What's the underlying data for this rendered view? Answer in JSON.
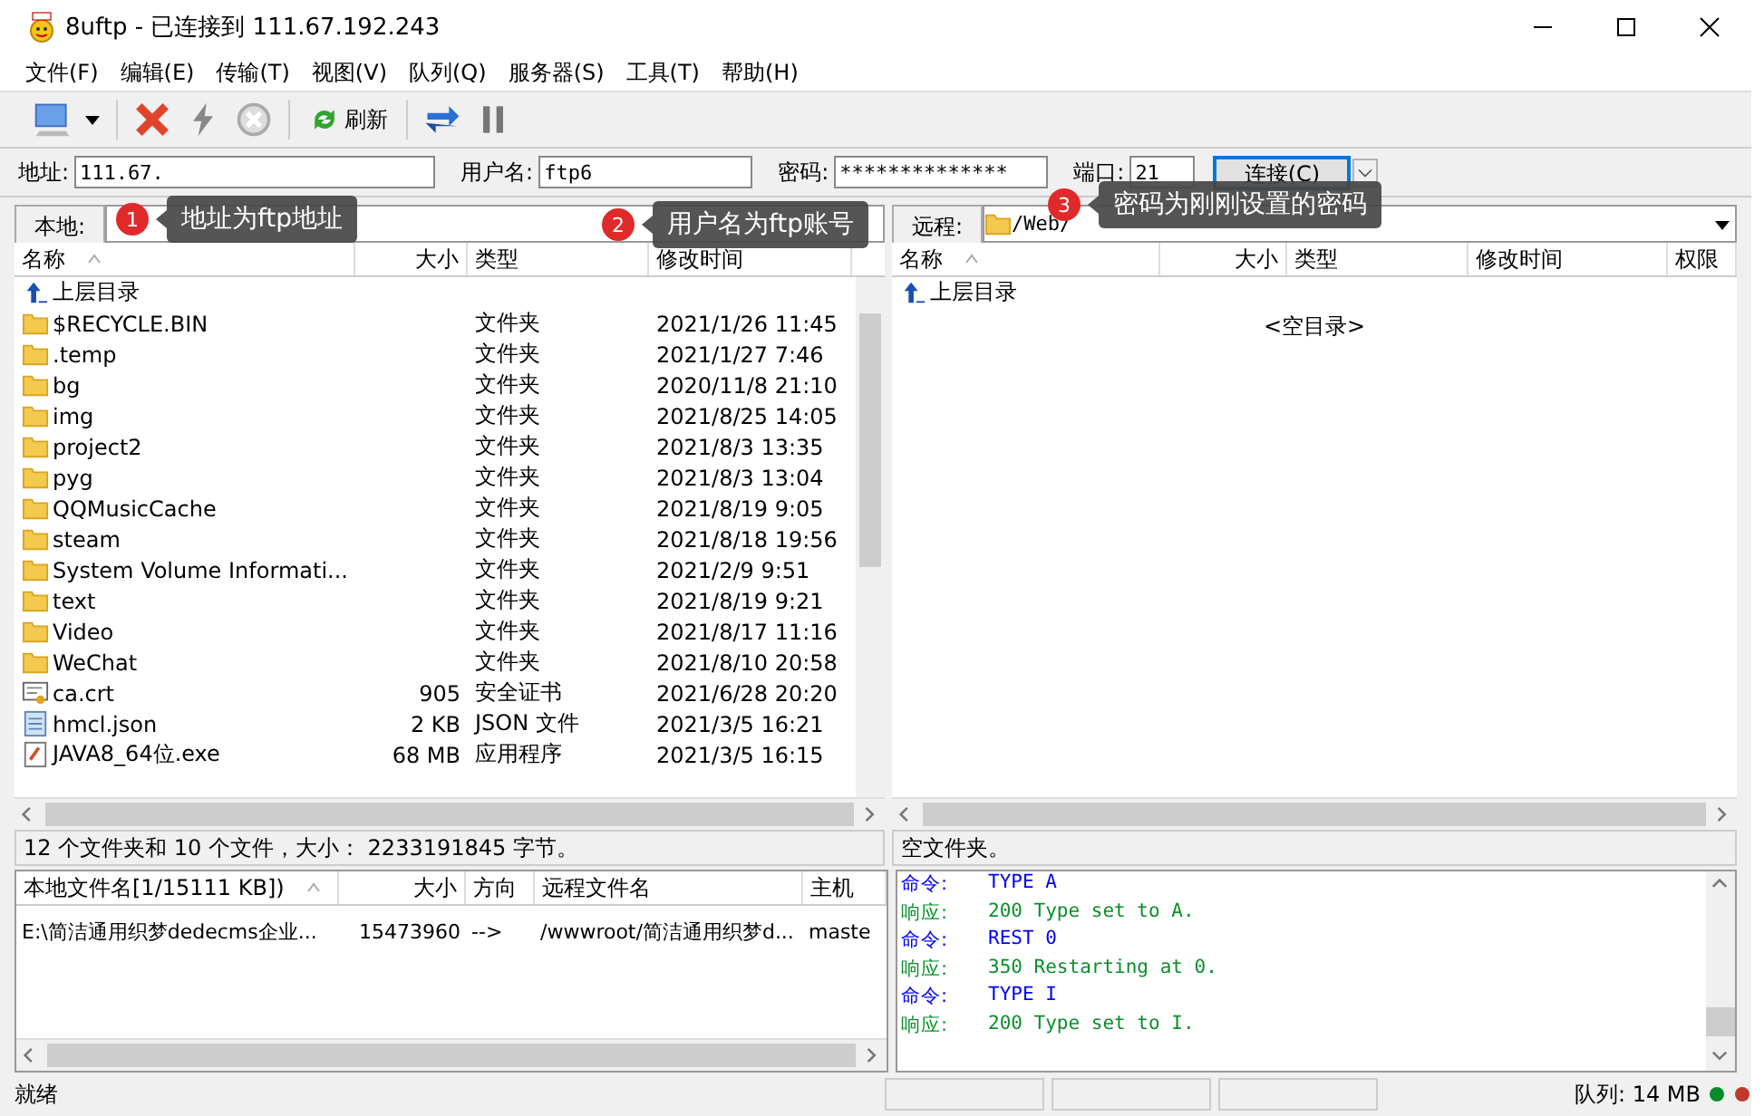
{
  "window": {
    "title": "8uftp - 已连接到 111.67.192.243"
  },
  "menu": [
    "文件(F)",
    "编辑(E)",
    "传输(T)",
    "视图(V)",
    "队列(Q)",
    "服务器(S)",
    "工具(T)",
    "帮助(H)"
  ],
  "toolbar": {
    "refresh_label": "刷新"
  },
  "connect_bar": {
    "address_label": "地址:",
    "address_value": "111.67.",
    "user_label": "用户名:",
    "user_value": "ftp6",
    "password_label": "密码:",
    "password_value": "**************",
    "port_label": "端口:",
    "port_value": "21",
    "connect_button": "连接(C)"
  },
  "local": {
    "label": "本地:",
    "columns": [
      "名称",
      "大小",
      "类型",
      "修改时间"
    ],
    "rows": [
      {
        "kind": "up",
        "name": "上层目录"
      },
      {
        "kind": "folder",
        "name": "$RECYCLE.BIN",
        "size": "",
        "type": "文件夹",
        "modified": "2021/1/26 11:45"
      },
      {
        "kind": "folder",
        "name": ".temp",
        "type": "文件夹",
        "modified": "2021/1/27 7:46"
      },
      {
        "kind": "folder",
        "name": "bg",
        "type": "文件夹",
        "modified": "2020/11/8 21:10"
      },
      {
        "kind": "folder",
        "name": "img",
        "type": "文件夹",
        "modified": "2021/8/25 14:05"
      },
      {
        "kind": "folder",
        "name": "project2",
        "type": "文件夹",
        "modified": "2021/8/3 13:35"
      },
      {
        "kind": "folder",
        "name": "pyg",
        "type": "文件夹",
        "modified": "2021/8/3 13:04"
      },
      {
        "kind": "folder",
        "name": "QQMusicCache",
        "type": "文件夹",
        "modified": "2021/8/19 9:05"
      },
      {
        "kind": "folder",
        "name": "steam",
        "type": "文件夹",
        "modified": "2021/8/18 19:56"
      },
      {
        "kind": "folder",
        "name": "System Volume Informati...",
        "type": "文件夹",
        "modified": "2021/2/9 9:51"
      },
      {
        "kind": "folder",
        "name": "text",
        "type": "文件夹",
        "modified": "2021/8/19 9:21"
      },
      {
        "kind": "folder",
        "name": "Video",
        "type": "文件夹",
        "modified": "2021/8/17 11:16"
      },
      {
        "kind": "folder",
        "name": "WeChat",
        "type": "文件夹",
        "modified": "2021/8/10 20:58"
      },
      {
        "kind": "cert",
        "name": "ca.crt",
        "size": "905",
        "type": "安全证书",
        "modified": "2021/6/28 20:20"
      },
      {
        "kind": "json",
        "name": "hmcl.json",
        "size": "2 KB",
        "type": "JSON 文件",
        "modified": "2021/3/5 16:21"
      },
      {
        "kind": "exe",
        "name": "JAVA8_64位.exe",
        "size": "68 MB",
        "type": "应用程序",
        "modified": "2021/3/5 16:15"
      }
    ],
    "summary": "12 个文件夹和 10 个文件，大小： 2233191845 字节。"
  },
  "remote": {
    "label": "远程:",
    "path": "/Web/",
    "columns": [
      "名称",
      "大小",
      "类型",
      "修改时间",
      "权限"
    ],
    "rows": [
      {
        "kind": "up",
        "name": "上层目录"
      }
    ],
    "empty_text": "<空目录>",
    "summary": "空文件夹。"
  },
  "queue": {
    "columns": [
      "本地文件名[1/15111 KB])",
      "大小",
      "方向",
      "远程文件名",
      "主机"
    ],
    "rows": [
      [
        "E:\\简洁通用织梦dedecms企业...",
        "15473960",
        "-->",
        "/wwwroot/简洁通用织梦d...",
        "maste"
      ]
    ]
  },
  "log": [
    {
      "kind": "command",
      "label": "命令:",
      "text": "TYPE A"
    },
    {
      "kind": "response",
      "label": "响应:",
      "text": "200 Type set to A."
    },
    {
      "kind": "command",
      "label": "命令:",
      "text": "REST 0"
    },
    {
      "kind": "response",
      "label": "响应:",
      "text": "350 Restarting at 0."
    },
    {
      "kind": "command",
      "label": "命令:",
      "text": "TYPE I"
    },
    {
      "kind": "response",
      "label": "响应:",
      "text": "200 Type set to I."
    }
  ],
  "status_bar": {
    "text": "就绪",
    "queue": "队列: 14 MB"
  },
  "callouts": [
    {
      "number": "1",
      "text": "地址为ftp地址"
    },
    {
      "number": "2",
      "text": "用户名为ftp账号"
    },
    {
      "number": "3",
      "text": "密码为刚刚设置的密码"
    }
  ]
}
